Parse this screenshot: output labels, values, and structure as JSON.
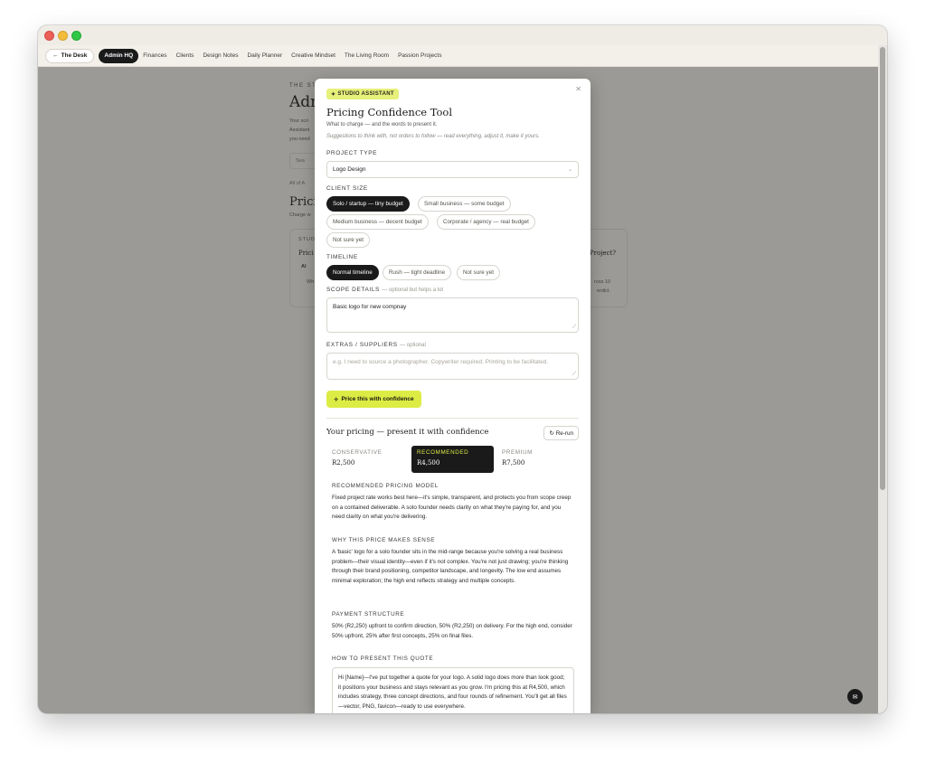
{
  "nav": {
    "back_label": "The Desk",
    "items": [
      "Admin HQ",
      "Finances",
      "Clients",
      "Design Notes",
      "Daily Planner",
      "Creative Mindset",
      "The Living Room",
      "Passion Projects"
    ],
    "active": "Admin HQ"
  },
  "background": {
    "eyebrow": "THE ST",
    "title": "Adm",
    "line1": "Your scri",
    "line2": "Assistant",
    "line3": "you need",
    "search": "Sea",
    "crumb": "All of A",
    "heading": "Prici",
    "caption": "Charge w",
    "card_label": "STUD",
    "card_title": "Prici",
    "card_badge": "AI",
    "card_text": "Wh",
    "right_title": "Project?",
    "right_text1": "ross 10",
    "right_text2": "erdict."
  },
  "modal": {
    "badge": "STUDIO ASSISTANT",
    "title": "Pricing Confidence Tool",
    "subtitle": "What to charge — and the words to present it.",
    "hint": "Suggestions to think with, not orders to follow — read everything, adjust it, make it yours.",
    "project_type_label": "PROJECT TYPE",
    "project_type_value": "Logo Design",
    "client_size_label": "CLIENT SIZE",
    "client_sizes": [
      "Solo / startup — tiny budget",
      "Small business — some budget",
      "Medium business — decent budget",
      "Corporate / agency — real budget",
      "Not sure yet"
    ],
    "client_size_selected": "Solo / startup — tiny budget",
    "timeline_label": "TIMELINE",
    "timelines": [
      "Normal timeline",
      "Rush — tight deadline",
      "Not sure yet"
    ],
    "timeline_selected": "Normal timeline",
    "scope_label": "SCOPE DETAILS",
    "scope_optional": "— optional but helps a lot",
    "scope_value": "Basic logo for new compnay",
    "extras_label": "EXTRAS / SUPPLIERS",
    "extras_optional": "— optional",
    "extras_placeholder": "e.g. I need to source a photographer. Copywriter required. Printing to be facilitated.",
    "cta_label": "Price this with confidence",
    "results_title": "Your pricing — present it with confidence",
    "rerun_label": "Re-run",
    "tiers": [
      {
        "name": "CONSERVATIVE",
        "price": "R2,500"
      },
      {
        "name": "RECOMMENDED",
        "price": "R4,500"
      },
      {
        "name": "PREMIUM",
        "price": "R7,500"
      }
    ],
    "sections": [
      {
        "heading": "RECOMMENDED PRICING MODEL",
        "body": "Fixed project rate works best here—it's simple, transparent, and protects you from scope creep on a contained deliverable. A solo founder needs clarity on what they're paying for, and you need clarity on what you're delivering."
      },
      {
        "heading": "WHY THIS PRICE MAKES SENSE",
        "body": "A 'basic' logo for a solo founder sits in the mid-range because you're solving a real business problem—their visual identity—even if it's not complex. You're not just drawing; you're thinking through their brand positioning, competitor landscape, and longevity. The low end assumes minimal exploration; the high end reflects strategy and multiple concepts."
      },
      {
        "heading": "PAYMENT STRUCTURE",
        "body": "50% (R2,250) upfront to confirm direction, 50% (R2,250) on delivery. For the high end, consider 50% upfront, 25% after first concepts, 25% on final files."
      },
      {
        "heading": "HOW TO PRESENT THIS QUOTE",
        "body": "Hi [Name]—I've put together a quote for your logo. A solid logo does more than look good; it positions your business and stays relevant as you grow. I'm pricing this at R4,500, which includes strategy, three concept directions, and four rounds of refinement. You'll get all files—vector, PNG, favicon—ready to use everywhere."
      }
    ]
  },
  "colors": {
    "accent": "#dcec45",
    "dark": "#1a1a1a",
    "overlay": "#9c9a96"
  }
}
